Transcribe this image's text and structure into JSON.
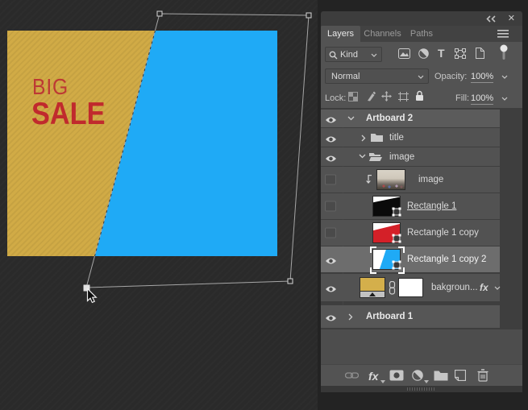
{
  "canvas": {
    "big_text": "BIG",
    "sale_text": "SALE",
    "artboard_color": "#d1ab46",
    "shape_color": "#1faaf6",
    "text_color": "#c02a2d"
  },
  "panel": {
    "window": {
      "close_glyph": "✕"
    },
    "tabs": [
      {
        "label": "Layers",
        "active": true
      },
      {
        "label": "Channels",
        "active": false
      },
      {
        "label": "Paths",
        "active": false
      }
    ],
    "filter": {
      "kind_label": "Kind",
      "type_glyph": "T"
    },
    "blend": {
      "mode": "Normal",
      "opacity_label": "Opacity:",
      "opacity_value": "100%"
    },
    "lock": {
      "label": "Lock:",
      "fill_label": "Fill:",
      "fill_value": "100%"
    },
    "rows": [
      {
        "label": "Artboard 2",
        "type": "artboard",
        "visible": true,
        "expanded": true
      },
      {
        "label": "title",
        "type": "group",
        "visible": true,
        "expanded": false
      },
      {
        "label": "image",
        "type": "group",
        "visible": true,
        "expanded": true
      },
      {
        "label": "image",
        "type": "image-layer",
        "visible": false,
        "clipped": true
      },
      {
        "label": "Rectangle 1",
        "type": "shape-layer",
        "visible": false,
        "clip_base": true
      },
      {
        "label": "Rectangle 1 copy",
        "type": "shape-layer",
        "visible": false
      },
      {
        "label": "Rectangle 1 copy 2",
        "type": "shape-layer",
        "visible": true,
        "selected": true
      },
      {
        "label": "bakgroun...",
        "type": "fill-layer",
        "visible": true,
        "fx_label": "fx",
        "has_mask": true
      },
      {
        "label": "Artboard 1",
        "type": "artboard",
        "visible": true,
        "expanded": false
      }
    ],
    "toolbar": {
      "fx_label": "fx"
    }
  }
}
